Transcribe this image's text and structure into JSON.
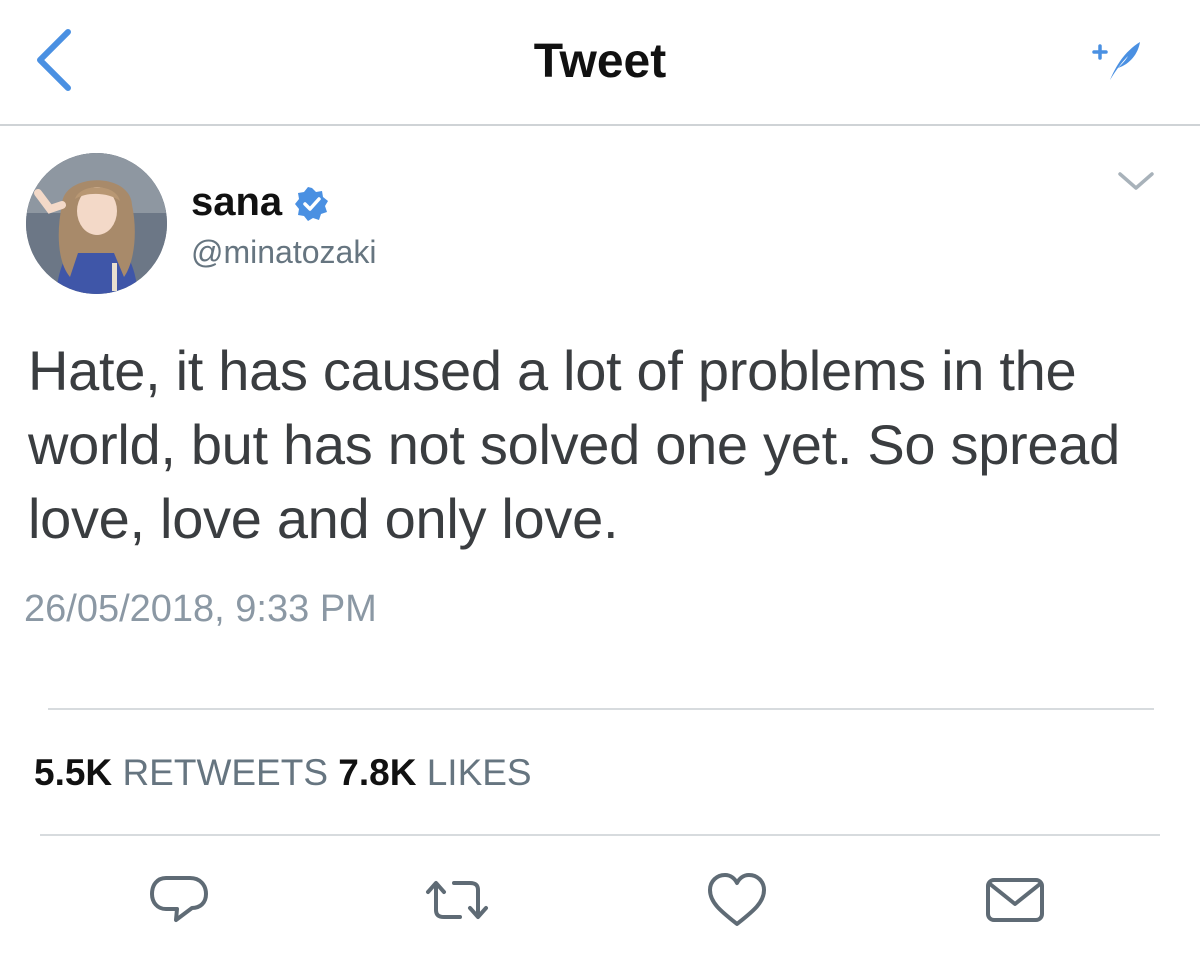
{
  "header": {
    "title": "Tweet",
    "back_icon": "chevron-left-icon",
    "compose_icon": "compose-feather-icon"
  },
  "author": {
    "display_name": "sana",
    "handle": "@minatozaki",
    "verified": true,
    "avatar": "profile-photo"
  },
  "tweet": {
    "text": "Hate, it has caused a lot of problems in the world, but has not solved one yet. So spread love, love and only love.",
    "timestamp": "26/05/2018, 9:33 PM"
  },
  "stats": {
    "retweets_count": "5.5K",
    "retweets_label": "RETWEETS",
    "likes_count": "7.8K",
    "likes_label": "LIKES"
  },
  "actions": [
    "reply-icon",
    "retweet-icon",
    "like-icon",
    "share-icon"
  ],
  "colors": {
    "accent": "#4a90e2",
    "icon_gray": "#5f6b75",
    "text_secondary": "#667580",
    "divider": "#d7dbde"
  }
}
